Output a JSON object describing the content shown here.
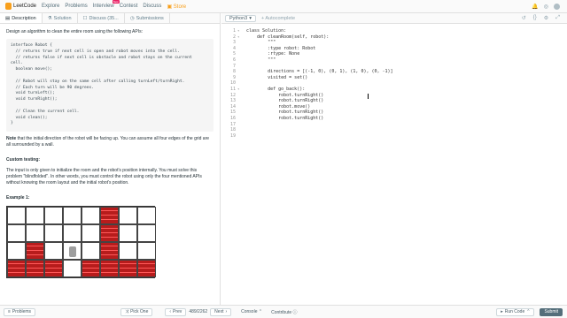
{
  "nav": {
    "logo": "LeetCode",
    "items": [
      "Explore",
      "Problems",
      "Interview",
      "Contest",
      "Discuss",
      "Store"
    ],
    "new_badge": "New"
  },
  "tabs": [
    {
      "label": "Description",
      "icon": "document-icon"
    },
    {
      "label": "Solution",
      "icon": "flask-icon"
    },
    {
      "label": "Discuss (35...",
      "icon": "chat-icon"
    },
    {
      "label": "Submissions",
      "icon": "history-icon"
    }
  ],
  "description": {
    "intro": "Design an algorithm to clean the entire room using the following APIs:",
    "api_code": "interface Robot {\n  // returns true if next cell is open and robot moves into the cell.\n  // returns false if next cell is obstacle and robot stays on the current\ncell.\n  boolean move();\n\n  // Robot will stay on the same cell after calling turnLeft/turnRight.\n  // Each turn will be 90 degrees.\n  void turnLeft();\n  void turnRight();\n\n  // Clean the current cell.\n  void clean();\n}",
    "note_bold": "Note",
    "note_text": " that the initial direction of the robot will be facing up. You can assume all four edges of the grid are all surrounded by a wall.",
    "custom_title": "Custom testing:",
    "custom_text": "The input is only given to initialize the room and the robot's position internally. You must solve this problem \"blindfolded\". In other words, you must control the robot using only the four mentioned APIs without knowing the room layout and the initial robot's position.",
    "example_title": "Example 1:",
    "grid": [
      [
        0,
        0,
        0,
        0,
        0,
        1,
        0,
        0
      ],
      [
        0,
        0,
        0,
        0,
        0,
        1,
        0,
        0
      ],
      [
        0,
        1,
        0,
        2,
        0,
        1,
        0,
        0
      ],
      [
        1,
        1,
        1,
        0,
        1,
        1,
        1,
        1
      ]
    ]
  },
  "editor": {
    "language": "Python3",
    "autocomplete": "Autocomplete",
    "lines": [
      {
        "n": "1",
        "fold": true,
        "text": "class Solution:"
      },
      {
        "n": "2",
        "fold": true,
        "text": "    def cleanRoom(self, robot):"
      },
      {
        "n": "3",
        "fold": false,
        "text": "        \"\"\""
      },
      {
        "n": "4",
        "fold": false,
        "text": "        :type robot: Robot"
      },
      {
        "n": "5",
        "fold": false,
        "text": "        :rtype: None"
      },
      {
        "n": "6",
        "fold": false,
        "text": "        \"\"\""
      },
      {
        "n": "7",
        "fold": false,
        "text": ""
      },
      {
        "n": "8",
        "fold": false,
        "text": "        directions = [(-1, 0), (0, 1), (1, 0), (0, -1)]"
      },
      {
        "n": "9",
        "fold": false,
        "text": "        visited = set()"
      },
      {
        "n": "10",
        "fold": false,
        "text": ""
      },
      {
        "n": "11",
        "fold": true,
        "text": "        def go_back():"
      },
      {
        "n": "12",
        "fold": false,
        "text": "            robot.turnRight()"
      },
      {
        "n": "13",
        "fold": false,
        "text": "            robot.turnRight()"
      },
      {
        "n": "14",
        "fold": false,
        "text": "            robot.move()"
      },
      {
        "n": "15",
        "fold": false,
        "text": "            robot.turnRight()"
      },
      {
        "n": "16",
        "fold": false,
        "text": "            robot.turnRight()"
      },
      {
        "n": "17",
        "fold": false,
        "text": ""
      },
      {
        "n": "18",
        "fold": false,
        "text": ""
      },
      {
        "n": "19",
        "fold": false,
        "text": ""
      }
    ]
  },
  "footer": {
    "problems": "Problems",
    "pick_one": "Pick One",
    "prev": "Prev",
    "page": "489/2262",
    "next": "Next",
    "console": "Console",
    "contribute": "Contribute",
    "run_code": "Run Code",
    "submit": "Submit"
  }
}
